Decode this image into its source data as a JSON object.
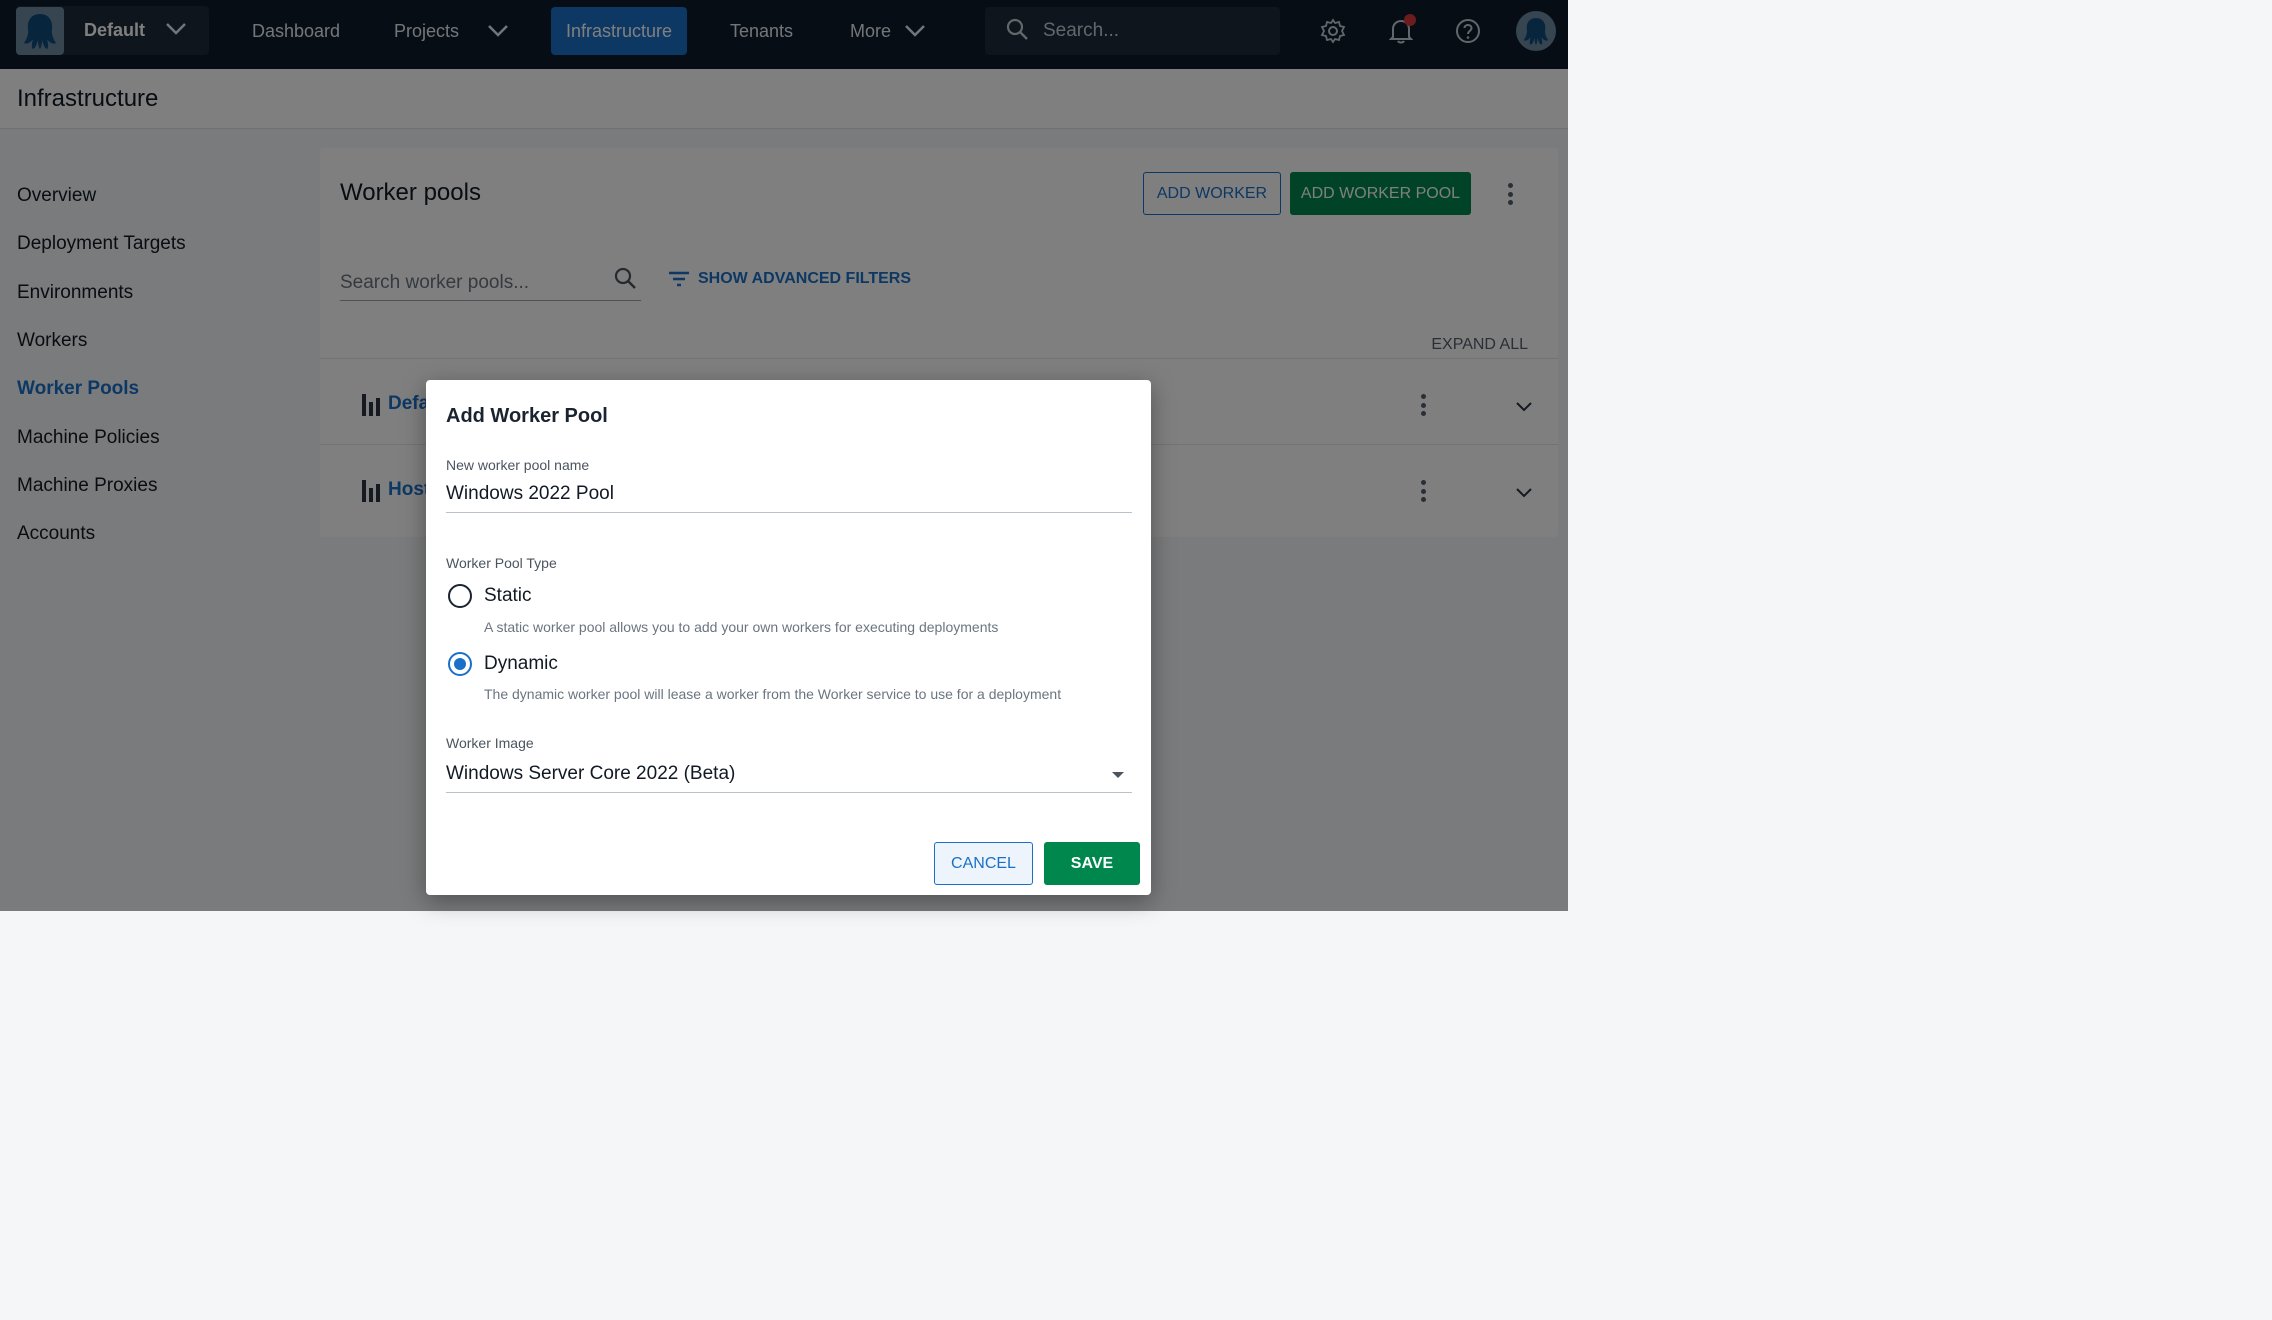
{
  "topnav": {
    "space_name": "Default",
    "items": [
      {
        "label": "Dashboard"
      },
      {
        "label": "Projects"
      },
      {
        "label": "Infrastructure"
      },
      {
        "label": "Tenants"
      },
      {
        "label": "More"
      }
    ],
    "active_item": "Infrastructure",
    "search_placeholder": "Search...",
    "icons": [
      "settings-icon",
      "bell-icon",
      "help-icon"
    ],
    "notification_color": "#d63b3b"
  },
  "page": {
    "title": "Infrastructure"
  },
  "sidebar": {
    "items": [
      {
        "label": "Overview"
      },
      {
        "label": "Deployment Targets"
      },
      {
        "label": "Environments"
      },
      {
        "label": "Workers"
      },
      {
        "label": "Worker Pools"
      },
      {
        "label": "Machine Policies"
      },
      {
        "label": "Machine Proxies"
      },
      {
        "label": "Accounts"
      }
    ],
    "active_item": "Worker Pools"
  },
  "card": {
    "title": "Worker pools",
    "add_worker_label": "ADD WORKER",
    "add_pool_label": "ADD WORKER POOL",
    "search_placeholder": "Search worker pools...",
    "advanced_filters_label": "SHOW ADVANCED FILTERS",
    "expand_all_label": "EXPAND ALL",
    "rows": [
      {
        "name": "Defa"
      },
      {
        "name": "Host"
      }
    ]
  },
  "dialog": {
    "title": "Add Worker Pool",
    "name_label": "New worker pool name",
    "name_value": "Windows 2022 Pool",
    "type_label": "Worker Pool Type",
    "options": [
      {
        "label": "Static",
        "help": "A static worker pool allows you to add your own workers for executing deployments",
        "selected": false
      },
      {
        "label": "Dynamic",
        "help": "The dynamic worker pool will lease a worker from the Worker service to use for a deployment",
        "selected": true
      }
    ],
    "image_label": "Worker Image",
    "image_value": "Windows Server Core 2022 (Beta)",
    "cancel_label": "CANCEL",
    "save_label": "SAVE"
  },
  "colors": {
    "nav_bg": "#0e1a29",
    "accent_blue": "#1a70c8",
    "primary_green": "#00874d"
  }
}
